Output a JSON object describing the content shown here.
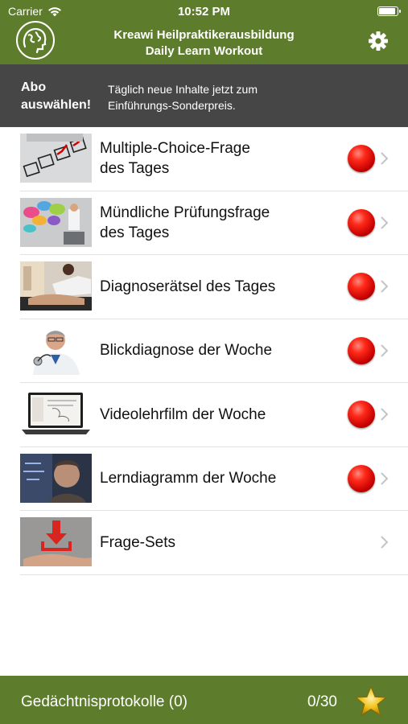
{
  "status_bar": {
    "carrier": "Carrier",
    "time": "10:52 PM"
  },
  "header": {
    "title_line1": "Kreawi Heilpraktikerausbildung",
    "title_line2": "Daily Learn Workout",
    "logo_icon": "head-globe-icon",
    "settings_icon": "gear-icon"
  },
  "promo": {
    "button_line1": "Abo",
    "button_line2": "auswählen!",
    "text_line1": "Täglich neue Inhalte jetzt zum",
    "text_line2": "Einführungs-Sonderpreis."
  },
  "list": {
    "items": [
      {
        "line1": "Multiple-Choice-Frage",
        "line2": "des Tages",
        "thumb": "checkbox-ballot-image",
        "badge": "red-indicator"
      },
      {
        "line1": "Mündliche Prüfungsfrage",
        "line2": "des Tages",
        "thumb": "speech-bubbles-image",
        "badge": "red-indicator"
      },
      {
        "line1": "Diagnoserätsel des Tages",
        "line2": "",
        "thumb": "physiotherapy-image",
        "badge": "red-indicator"
      },
      {
        "line1": "Blickdiagnose der Woche",
        "line2": "",
        "thumb": "doctor-stethoscope-image",
        "badge": "red-indicator"
      },
      {
        "line1": "Videolehrfilm der Woche",
        "line2": "",
        "thumb": "laptop-video-image",
        "badge": "red-indicator"
      },
      {
        "line1": "Lerndiagramm der Woche",
        "line2": "",
        "thumb": "man-diagram-image",
        "badge": "red-indicator"
      },
      {
        "line1": "Frage-Sets",
        "line2": "",
        "thumb": "download-hand-image",
        "badge": ""
      }
    ]
  },
  "bottom_bar": {
    "label": "Gedächtnisprotokolle (0)",
    "count": "0/30",
    "star_icon": "star-icon"
  },
  "colors": {
    "header_green": "#5d7d2c",
    "promo_gray": "#464646",
    "indicator_red": "#e00000"
  }
}
